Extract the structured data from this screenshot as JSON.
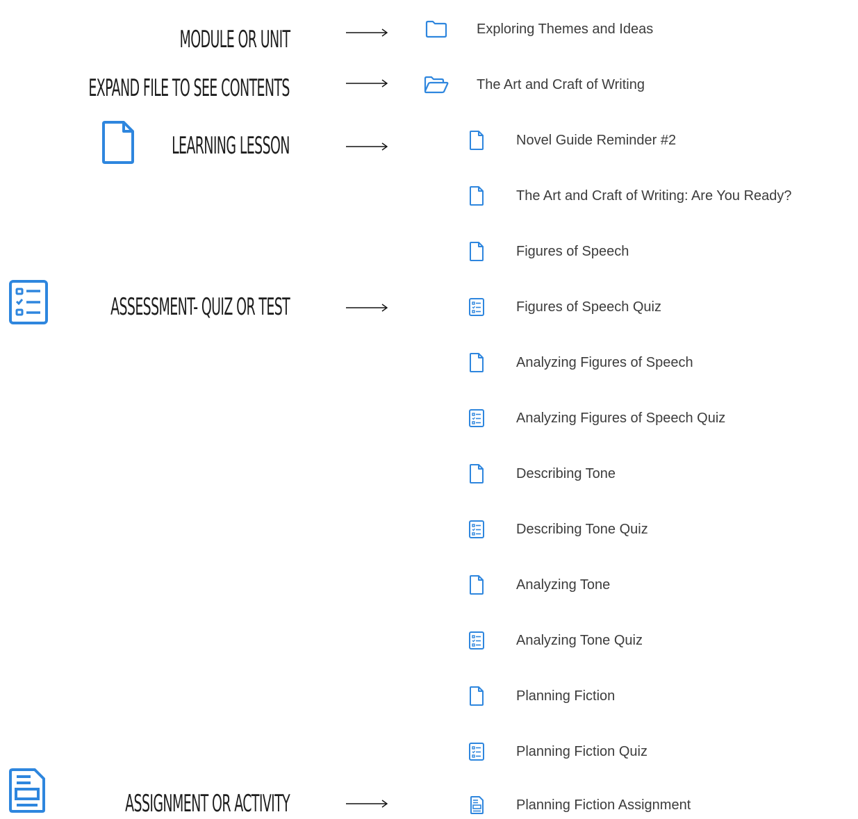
{
  "legend": {
    "module": "MODULE OR UNIT",
    "expand": "EXPAND FILE TO SEE CONTENTS",
    "lesson": "LEARNING LESSON",
    "assessment": "ASSESSMENT- QUIZ OR TEST",
    "assignment": "ASSIGNMENT OR ACTIVITY"
  },
  "colors": {
    "accent": "#2e86de",
    "text": "#3c3c3c",
    "legend_text": "#1d1d1d"
  },
  "modules": [
    {
      "label": "Exploring Themes and Ideas",
      "icon": "folder-icon",
      "state": "collapsed"
    },
    {
      "label": "The Art and Craft of Writing",
      "icon": "folder-open-icon",
      "state": "expanded"
    }
  ],
  "items": [
    {
      "label": "Novel Guide Reminder #2",
      "type": "lesson",
      "icon": "file-icon"
    },
    {
      "label": "The Art and Craft of Writing: Are You Ready?",
      "type": "lesson",
      "icon": "file-icon"
    },
    {
      "label": "Figures of Speech",
      "type": "lesson",
      "icon": "file-icon"
    },
    {
      "label": "Figures of Speech Quiz",
      "type": "quiz",
      "icon": "checklist-icon"
    },
    {
      "label": "Analyzing Figures of Speech",
      "type": "lesson",
      "icon": "file-icon"
    },
    {
      "label": "Analyzing Figures of Speech Quiz",
      "type": "quiz",
      "icon": "checklist-icon"
    },
    {
      "label": "Describing Tone",
      "type": "lesson",
      "icon": "file-icon"
    },
    {
      "label": "Describing Tone Quiz",
      "type": "quiz",
      "icon": "checklist-icon"
    },
    {
      "label": "Analyzing Tone",
      "type": "lesson",
      "icon": "file-icon"
    },
    {
      "label": "Analyzing Tone Quiz",
      "type": "quiz",
      "icon": "checklist-icon"
    },
    {
      "label": "Planning Fiction",
      "type": "lesson",
      "icon": "file-icon"
    },
    {
      "label": "Planning Fiction Quiz",
      "type": "quiz",
      "icon": "checklist-icon"
    },
    {
      "label": "Planning Fiction Assignment",
      "type": "assignment",
      "icon": "assignment-icon"
    }
  ]
}
